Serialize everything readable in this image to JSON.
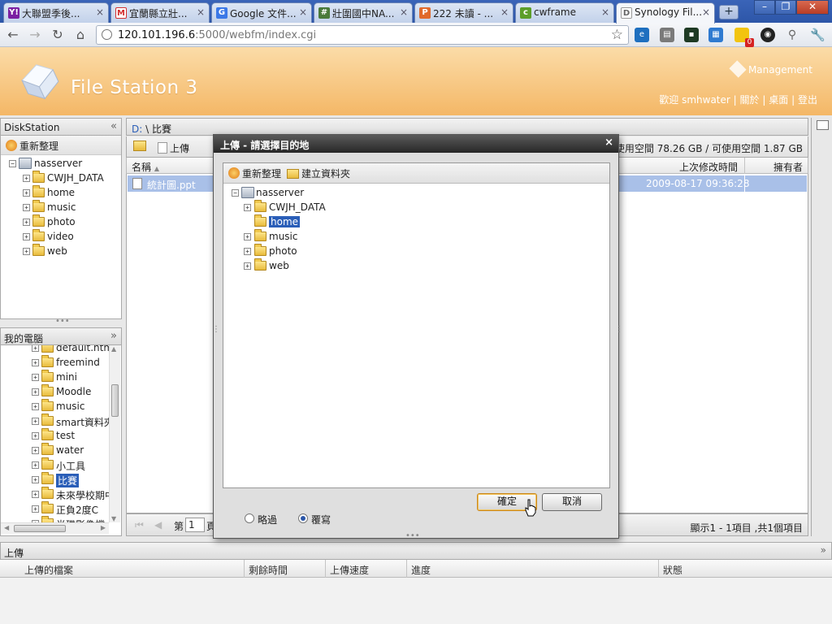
{
  "browser": {
    "tabs": [
      {
        "title": "大聯盟季後...",
        "favicon": "Y!"
      },
      {
        "title": "宜蘭縣立壯...",
        "favicon": "M"
      },
      {
        "title": "Google 文件...",
        "favicon": "G"
      },
      {
        "title": "壯圍國中NA...",
        "favicon": "#"
      },
      {
        "title": "222 未讀 - ...",
        "favicon": "P"
      },
      {
        "title": "cwframe",
        "favicon": "c"
      },
      {
        "title": "Synology Fil...",
        "favicon": "D"
      }
    ],
    "url_host": "120.101.196.6",
    "url_path": ":5000/webfm/index.cgi",
    "ext_badge": "0"
  },
  "banner": {
    "title": "File Station 3",
    "management": "Management",
    "welcome": "歡迎 smhwater",
    "about": "關於",
    "desktop": "桌面",
    "logout": "登出",
    "sep": "|"
  },
  "left": {
    "ds_title": "DiskStation",
    "refresh": "重新整理",
    "server": "nasserver",
    "ds_items": [
      "CWJH_DATA",
      "home",
      "music",
      "photo",
      "video",
      "web"
    ],
    "mypc_title": "我的電腦",
    "pc_items": [
      "default.html",
      "freemind",
      "mini",
      "Moodle",
      "music",
      "smart資料夾",
      "test",
      "water",
      "小工具",
      "比賽",
      "未來學校期中",
      "正負2度C",
      "半碟影像檔"
    ],
    "pc_selected": "比賽"
  },
  "main": {
    "path_drive": "D:",
    "path_rest": " \\ 比賽",
    "upload_btn": "上傳",
    "space": "已使用空間 78.26 GB / 可使用空間 1.87 GB",
    "col_name": "名稱",
    "col_sort": "▲",
    "col_modified": "上次修改時間",
    "col_owner": "擁有者",
    "file_name": "統計圖.ppt",
    "file_modified": "2009-08-17 09:36:28",
    "page_label": "第",
    "page_value": "1",
    "page_suffix": "頁",
    "status": "顯示1 - 1項目 ,共1個項目"
  },
  "upload_panel": {
    "title": "上傳",
    "cols": [
      "上傳的檔案",
      "剩餘時間",
      "上傳速度",
      "進度",
      "狀態"
    ]
  },
  "dialog": {
    "title": "上傳 - 請選擇目的地",
    "close": "×",
    "refresh": "重新整理",
    "new_folder": "建立資料夾",
    "server": "nasserver",
    "items": [
      "CWJH_DATA",
      "home",
      "music",
      "photo",
      "web"
    ],
    "selected": "home",
    "ok": "確定",
    "cancel": "取消",
    "skip": "略過",
    "overwrite": "覆寫",
    "overwrite_selected": true
  },
  "colors": {
    "accent": "#2a5eb8",
    "banner": "#f4b766",
    "selection_row": "#a9c0e8"
  }
}
